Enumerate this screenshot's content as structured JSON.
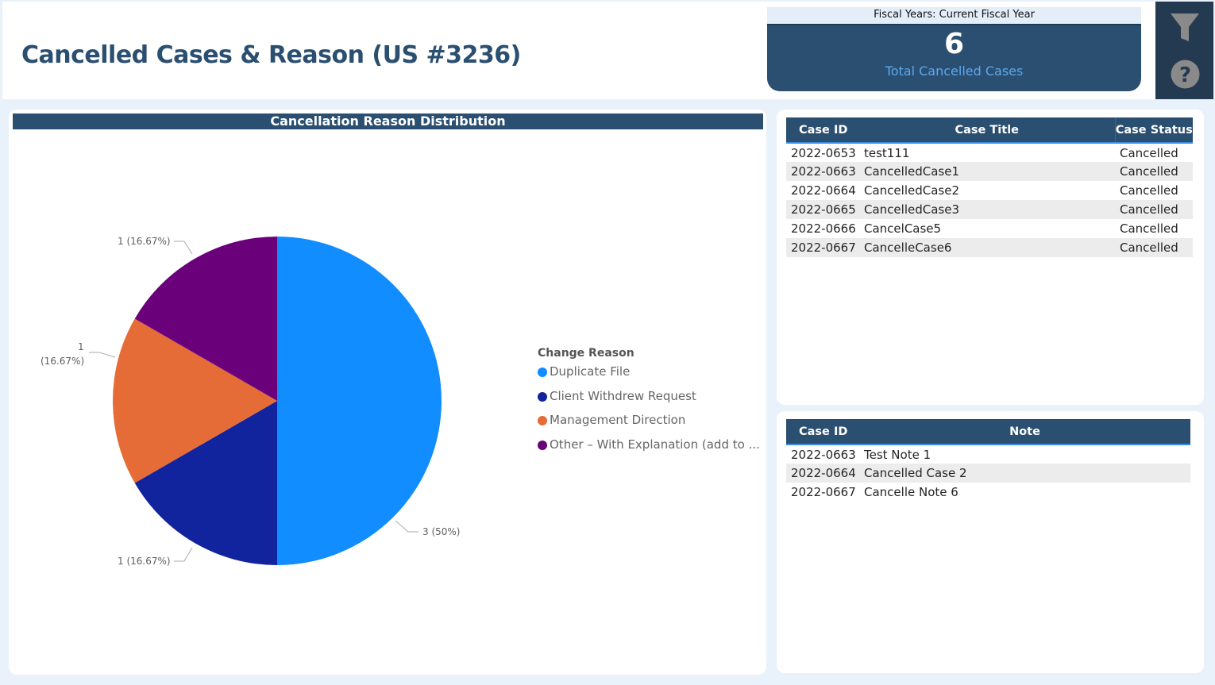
{
  "header": {
    "title": "Cancelled Cases & Reason (US #3236)"
  },
  "kpi": {
    "filter": "Fiscal Years: Current Fiscal Year",
    "value": "6",
    "label": "Total Cancelled Cases"
  },
  "side": {
    "filter_icon": "filter-icon",
    "help_icon": "help-icon"
  },
  "chart_data": {
    "type": "pie",
    "title": "Cancellation Reason Distribution",
    "legend_title": "Change Reason",
    "legend_position": "right",
    "categories": [
      "Duplicate File",
      "Client Withdrew Request",
      "Management Direction",
      "Other – With Explanation (add to ..."
    ],
    "values": [
      3,
      1,
      1,
      1
    ],
    "colors": [
      "#118dff",
      "#12239e",
      "#e66c37",
      "#6b007b"
    ],
    "labels": [
      "3 (50%)",
      "1 (16.67%)",
      "1",
      "(16.67%)",
      "1 (16.67%)"
    ]
  },
  "cases": {
    "headers": [
      "Case ID",
      "Case Title",
      "Case Status"
    ],
    "rows": [
      [
        "2022-0653",
        "test111",
        "Cancelled"
      ],
      [
        "2022-0663",
        "CancelledCase1",
        "Cancelled"
      ],
      [
        "2022-0664",
        "CancelledCase2",
        "Cancelled"
      ],
      [
        "2022-0665",
        "CancelledCase3",
        "Cancelled"
      ],
      [
        "2022-0666",
        "CancelCase5",
        "Cancelled"
      ],
      [
        "2022-0667",
        "CancelleCase6",
        "Cancelled"
      ]
    ]
  },
  "notes": {
    "headers": [
      "Case ID",
      "Note"
    ],
    "rows": [
      [
        "2022-0663",
        "Test Note 1"
      ],
      [
        "2022-0664",
        "Cancelled Case 2"
      ],
      [
        "2022-0667",
        "Cancelle Note 6"
      ]
    ]
  }
}
